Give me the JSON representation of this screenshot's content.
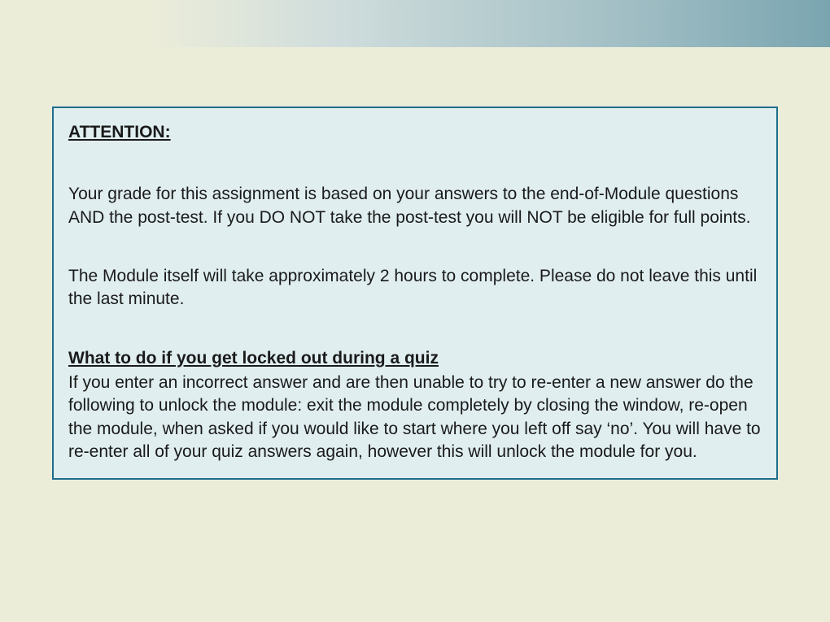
{
  "notice": {
    "title": "ATTENTION:",
    "paragraph1": "Your grade for this assignment is based on your answers to the end-of-Module questions AND the post-test.  If you DO NOT take the post-test you will NOT be eligible for full points.",
    "paragraph2": "The Module itself will take approximately 2 hours to complete.  Please do not leave this until the last minute.",
    "subheading": "What to do if you get locked out during a quiz",
    "paragraph3": "If you enter an incorrect answer and are then unable to try to re-enter a new answer do the following to unlock the module:  exit the module completely by closing the window, re-open the module, when asked if you would like to start where you left off say ‘no’.  You will have to re-enter all of your quiz answers again, however this will unlock the module for you."
  }
}
